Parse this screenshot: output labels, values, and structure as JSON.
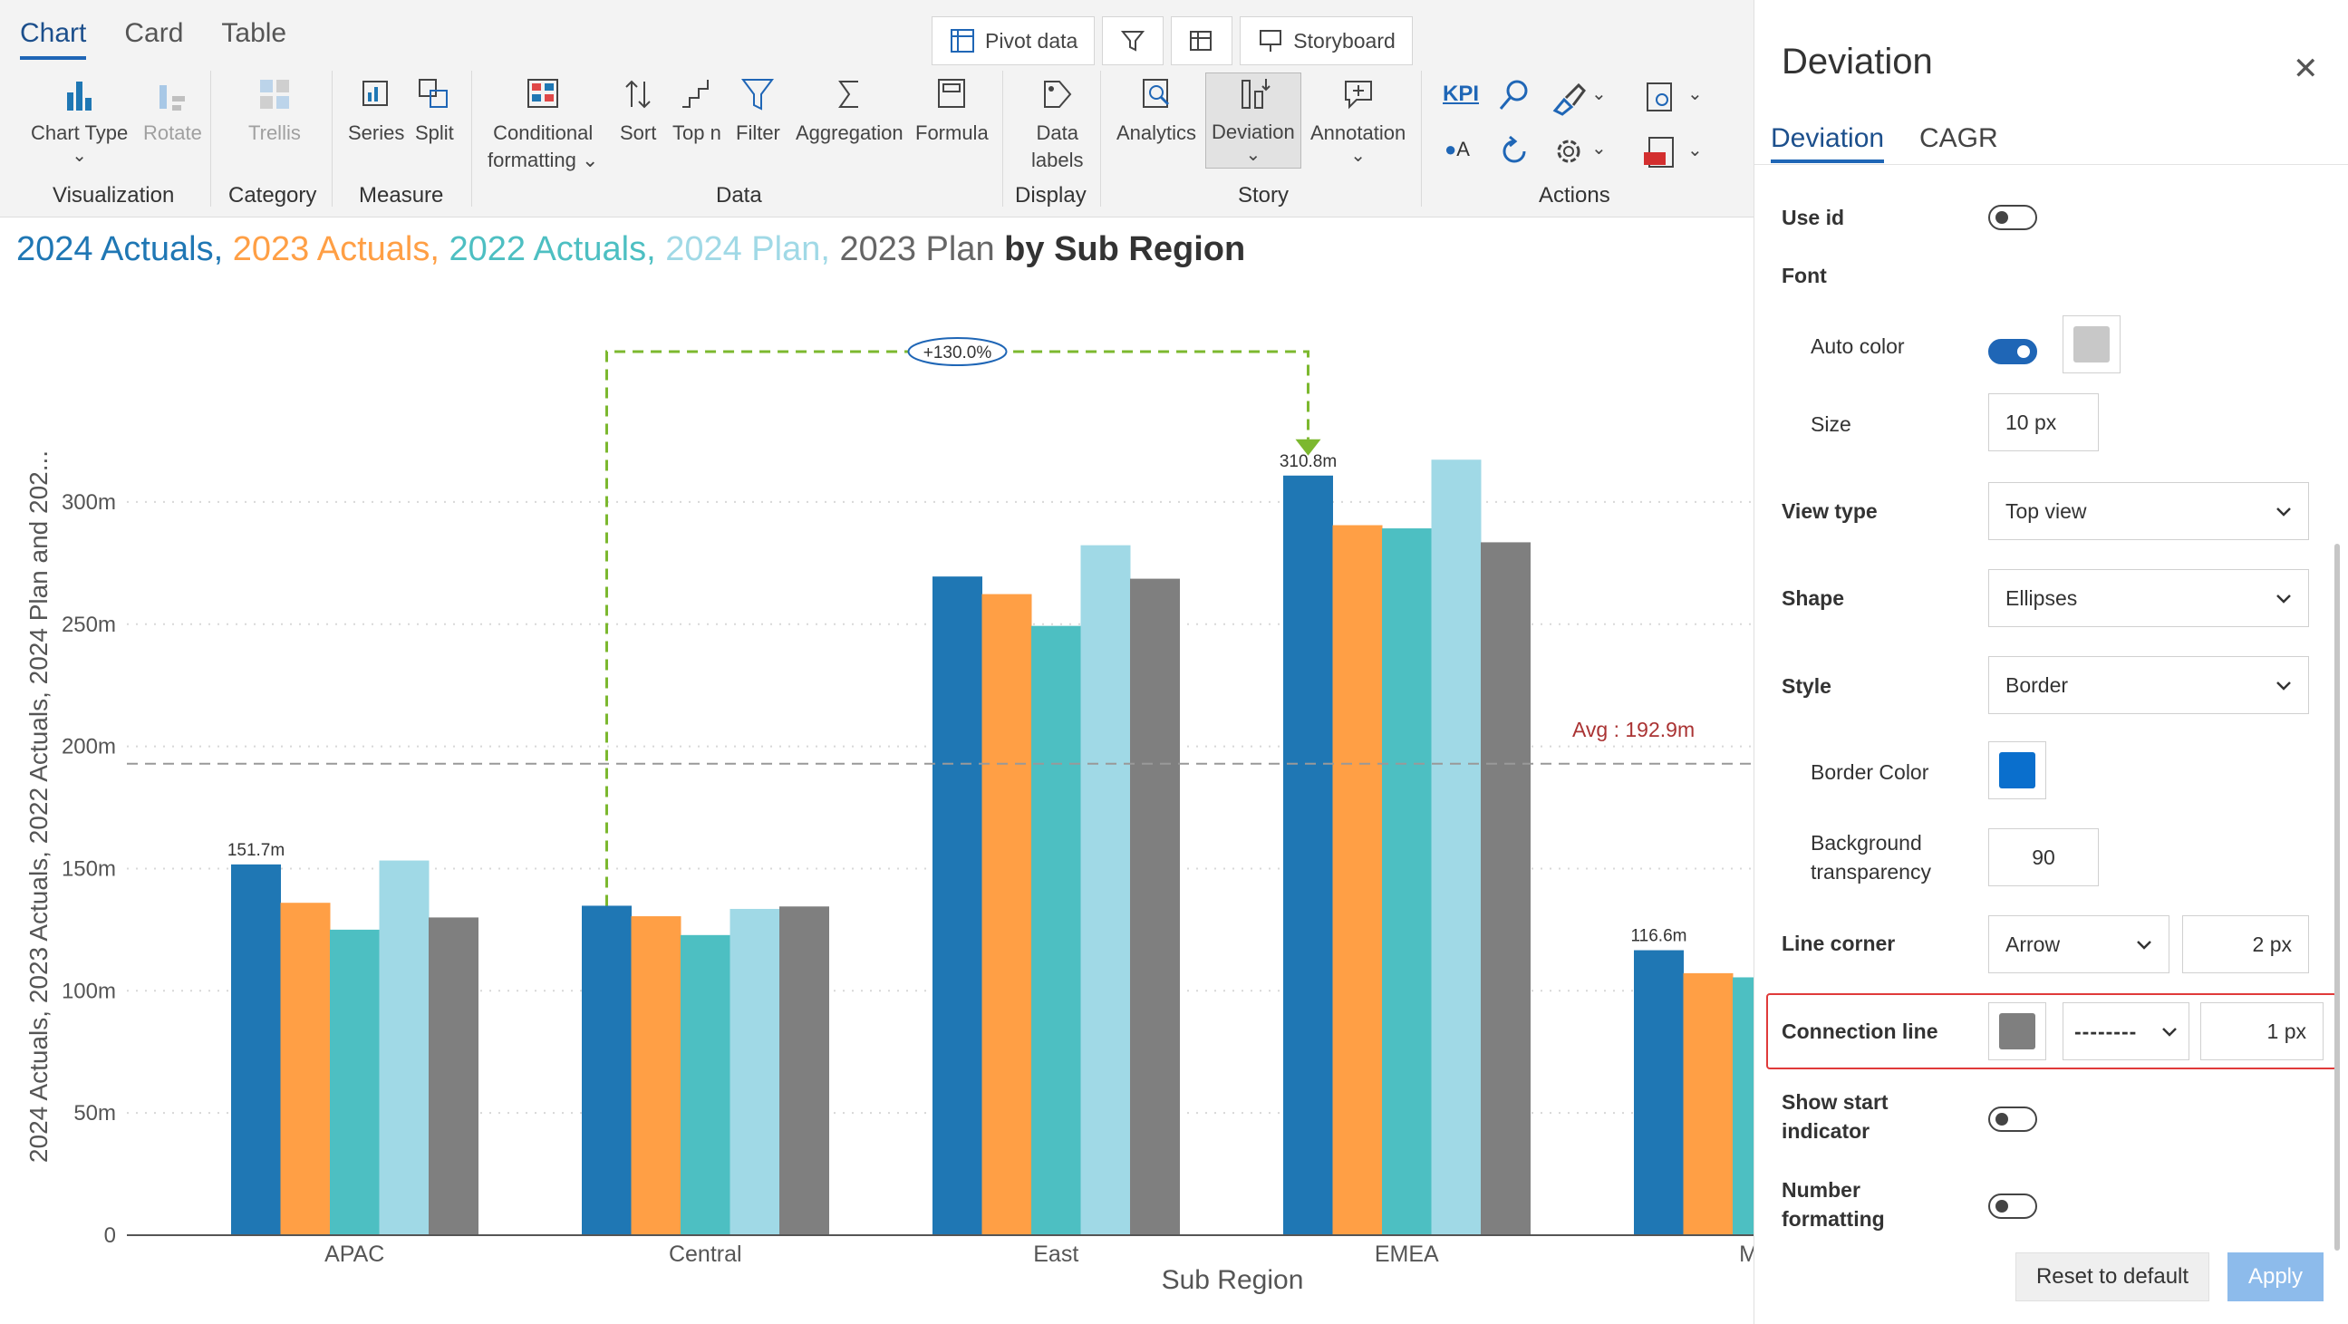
{
  "ribbon": {
    "tabs": [
      "Chart",
      "Card",
      "Table"
    ],
    "quick": {
      "pivot": "Pivot data",
      "storyboard": "Storyboard"
    },
    "tools": {
      "chart_type": "Chart Type",
      "rotate": "Rotate",
      "trellis": "Trellis",
      "series": "Series",
      "split": "Split",
      "cond1": "Conditional",
      "cond2": "formatting",
      "sort": "Sort",
      "topn": "Top n",
      "filter": "Filter",
      "aggregation": "Aggregation",
      "formula": "Formula",
      "data_labels1": "Data",
      "data_labels2": "labels",
      "analytics": "Analytics",
      "deviation": "Deviation",
      "annotation": "Annotation",
      "kpi": "KPI",
      "oa": "A"
    },
    "groups": [
      "Visualization",
      "Category",
      "Measure",
      "Data",
      "Display",
      "Story",
      "Actions"
    ]
  },
  "chart_data": {
    "type": "bar",
    "title_parts": [
      {
        "text": "2024 Actuals, ",
        "color": "#1f77b4"
      },
      {
        "text": "2023 Actuals, ",
        "color": "#ff9f45"
      },
      {
        "text": "2022 Actuals, ",
        "color": "#4dbfc2"
      },
      {
        "text": "2024 Plan, ",
        "color": "#a0d9e6"
      },
      {
        "text": "2023 Plan",
        "color": "#666666"
      },
      {
        "text": " by Sub Region",
        "color": "#333333"
      }
    ],
    "categories": [
      "APAC",
      "Central",
      "East",
      "EMEA",
      "Mid"
    ],
    "series": [
      {
        "name": "2024 Actuals",
        "color": "#1f77b4",
        "values": [
          151.7,
          134.8,
          269.5,
          310.8,
          116.6
        ]
      },
      {
        "name": "2023 Actuals",
        "color": "#ff9f45",
        "values": [
          136,
          130.5,
          262.3,
          290.5,
          107.2
        ]
      },
      {
        "name": "2022 Actuals",
        "color": "#4dbfc2",
        "values": [
          125,
          122.8,
          249.3,
          289.2,
          105.5
        ]
      },
      {
        "name": "2024 Plan",
        "color": "#a0d9e6",
        "values": [
          153.3,
          133.5,
          282.3,
          317.3,
          0
        ]
      },
      {
        "name": "2023 Plan",
        "color": "#7f7f7f",
        "values": [
          130,
          134.5,
          268.6,
          283.5,
          0
        ]
      }
    ],
    "ylabel": "2024 Actuals, 2023 Actuals, 2022 Actuals, 2024 Plan and 202...",
    "xlabel": "Sub Region",
    "ylim": [
      0,
      330
    ],
    "yticks": [
      0,
      50,
      100,
      150,
      200,
      250,
      300
    ],
    "ytick_labels": [
      "0",
      "50m",
      "100m",
      "150m",
      "200m",
      "250m",
      "300m"
    ],
    "data_labels": [
      {
        "category": "APAC",
        "text": "151.7m"
      },
      {
        "category": "EMEA",
        "text": "310.8m"
      },
      {
        "category": "Mid",
        "text": "116.6m"
      }
    ],
    "average": {
      "value": 192.9,
      "label": "Avg : 192.9m"
    },
    "deviation": {
      "from": "Central",
      "to": "EMEA",
      "label": "+130.0%",
      "color": "#7cb82f"
    },
    "grid": true
  },
  "panel": {
    "title": "Deviation",
    "tabs": [
      "Deviation",
      "CAGR"
    ],
    "use_id": "Use id",
    "font": "Font",
    "auto_color": "Auto color",
    "size": "Size",
    "size_value": "10 px",
    "view_type": "View type",
    "view_type_value": "Top view",
    "shape": "Shape",
    "shape_value": "Ellipses",
    "style": "Style",
    "style_value": "Border",
    "border_color": "Border Color",
    "border_color_hex": "#0a6fcd",
    "bg_transparency1": "Background",
    "bg_transparency2": "transparency",
    "bg_transparency_value": "90",
    "line_corner": "Line corner",
    "line_corner_value": "Arrow",
    "line_corner_px": "2 px",
    "connection_line": "Connection line",
    "connection_color_hex": "#7f7f7f",
    "connection_dash": "--------",
    "connection_px": "1 px",
    "show_start1": "Show start",
    "show_start2": "indicator",
    "number1": "Number",
    "number2": "formatting",
    "reset": "Reset to default",
    "apply": "Apply",
    "auto_color_swatch": "#c8c8c8"
  }
}
